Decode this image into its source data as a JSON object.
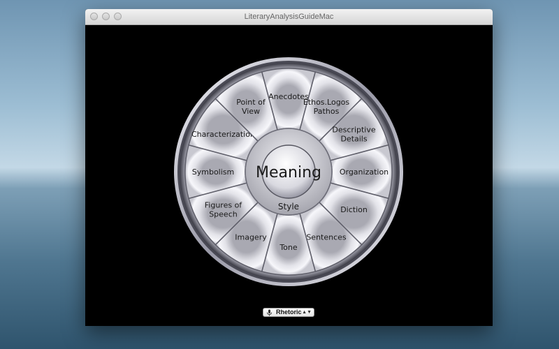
{
  "window": {
    "title": "LiteraryAnalysisGuideMac"
  },
  "wheel": {
    "segments": [
      {
        "key": "anecdotes",
        "lines": [
          "Anecdotes"
        ]
      },
      {
        "key": "ethos",
        "lines": [
          "Ethos.Logos",
          "Pathos"
        ]
      },
      {
        "key": "descriptive-details",
        "lines": [
          "Descriptive",
          "Details"
        ]
      },
      {
        "key": "organization",
        "lines": [
          "Organization"
        ]
      },
      {
        "key": "diction",
        "lines": [
          "Diction"
        ]
      },
      {
        "key": "sentences",
        "lines": [
          "Sentences"
        ]
      },
      {
        "key": "tone",
        "lines": [
          "Tone"
        ]
      },
      {
        "key": "imagery",
        "lines": [
          "Imagery"
        ]
      },
      {
        "key": "figures-of-speech",
        "lines": [
          "Figures of",
          "Speech"
        ]
      },
      {
        "key": "symbolism",
        "lines": [
          "Symbolism"
        ]
      },
      {
        "key": "characterization",
        "lines": [
          "Characterization"
        ]
      },
      {
        "key": "point-of-view",
        "lines": [
          "Point of",
          "View"
        ]
      }
    ],
    "center_label": "Meaning",
    "ring_label": "Style"
  },
  "selector": {
    "value": "Rhetoric",
    "icon": "microphone-icon"
  }
}
